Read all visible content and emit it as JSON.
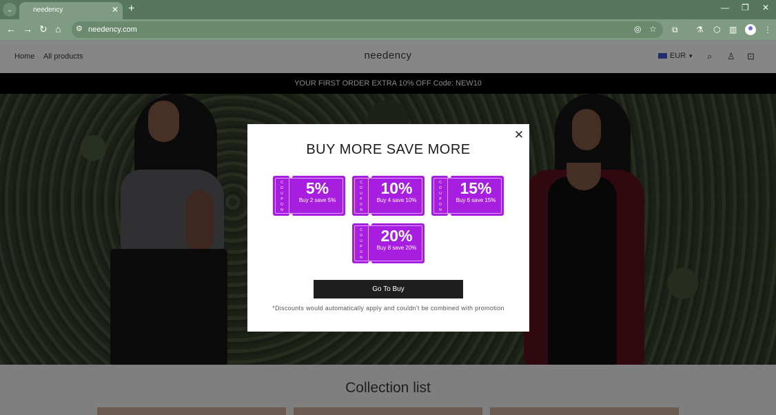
{
  "browser": {
    "tab_title": "needency",
    "url": "needency.com"
  },
  "header": {
    "nav": [
      "Home",
      "All products"
    ],
    "logo": "needency",
    "currency": "EUR"
  },
  "promo_bar": {
    "text": "YOUR FIRST ORDER EXTRA 10% OFF Code:  NEW10"
  },
  "collection": {
    "title": "Collection list"
  },
  "modal": {
    "title": "BUY MORE SAVE MORE",
    "coupons": [
      {
        "word": "COUPON",
        "percent": "5%",
        "desc": "Buy 2 save 5%"
      },
      {
        "word": "COUPON",
        "percent": "10%",
        "desc": "Buy 4 save 10%"
      },
      {
        "word": "COUPON",
        "percent": "15%",
        "desc": "Buy 6 save 15%"
      },
      {
        "word": "COUPON",
        "percent": "20%",
        "desc": "Buy 8 save 20%"
      }
    ],
    "button_label": "Go To Buy",
    "disclaimer": "*Discounts would automatically apply and couldn't be combined with promotion"
  },
  "colors": {
    "coupon": "#a81ee0",
    "button": "#1f1f1f",
    "browser_frame": "#56775b"
  },
  "icons": {
    "close": "close-icon",
    "search": "search-icon",
    "account": "account-icon",
    "cart": "cart-icon"
  }
}
